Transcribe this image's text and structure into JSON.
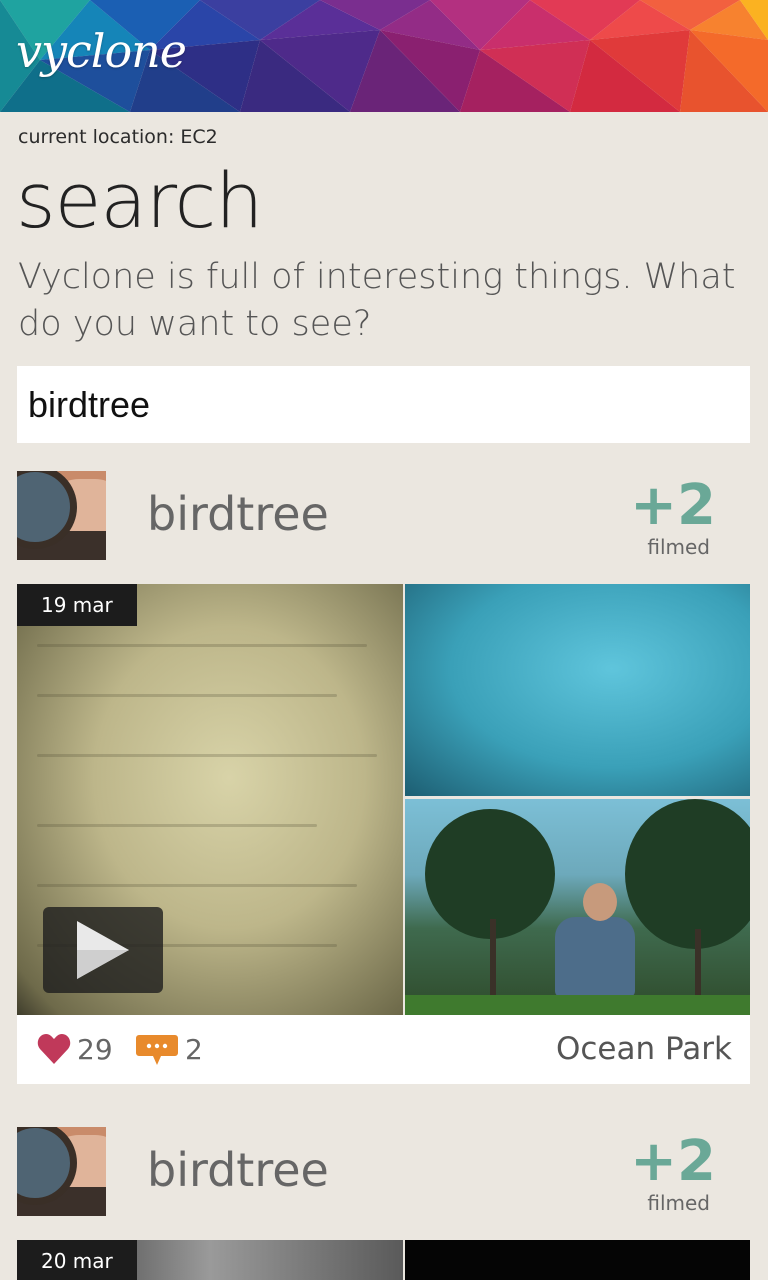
{
  "app": {
    "logo": "vyclone"
  },
  "location": {
    "label": "current location: EC2"
  },
  "page": {
    "title": "search",
    "description": "Vyclone is full of interesting things. What do you want to see?"
  },
  "search": {
    "value": "birdtree"
  },
  "results": [
    {
      "username": "birdtree",
      "plus": "+2",
      "filmed_label": "filmed",
      "date": "19 mar",
      "likes": "29",
      "comments": "2",
      "place": "Ocean Park"
    },
    {
      "username": "birdtree",
      "plus": "+2",
      "filmed_label": "filmed",
      "date": "20 mar"
    }
  ],
  "icons": {
    "like": "heart-icon",
    "comment": "comment-bubble-icon",
    "play": "play-icon"
  },
  "colors": {
    "background": "#ebe7e0",
    "accent_green": "#6aa897",
    "heart": "#c0395a",
    "comment": "#e88a2c"
  }
}
